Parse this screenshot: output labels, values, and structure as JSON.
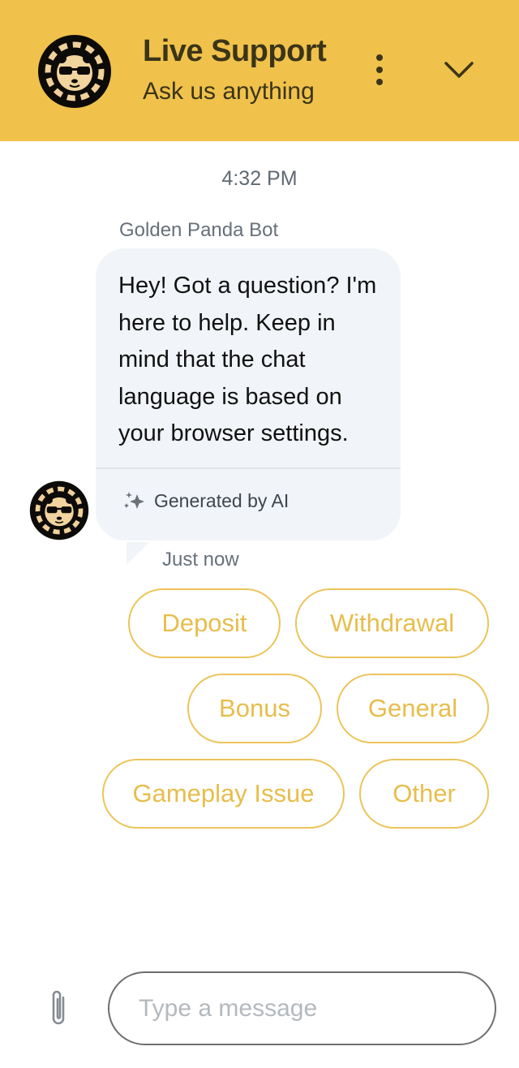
{
  "header": {
    "title": "Live Support",
    "subtitle": "Ask us anything",
    "avatar_icon": "panda-poker-chip-logo",
    "menu_icon": "more-vertical-icon",
    "collapse_icon": "chevron-down-icon",
    "background_color": "#f0c24b"
  },
  "conversation": {
    "timestamp": "4:32 PM",
    "messages": [
      {
        "sender": "Golden Panda Bot",
        "text": "Hey! Got a question? I'm here to help. Keep in mind that the chat language is based on your browser settings.",
        "ai_badge": "Generated by AI",
        "ai_icon": "sparkles-icon",
        "time": "Just now"
      }
    ],
    "quick_replies": [
      {
        "label": "Deposit"
      },
      {
        "label": "Withdrawal"
      },
      {
        "label": "Bonus"
      },
      {
        "label": "General"
      },
      {
        "label": "Gameplay Issue"
      },
      {
        "label": "Other"
      }
    ],
    "accent_color": "#ecc45a"
  },
  "composer": {
    "placeholder": "Type a message",
    "value": "",
    "attach_icon": "paperclip-icon"
  }
}
